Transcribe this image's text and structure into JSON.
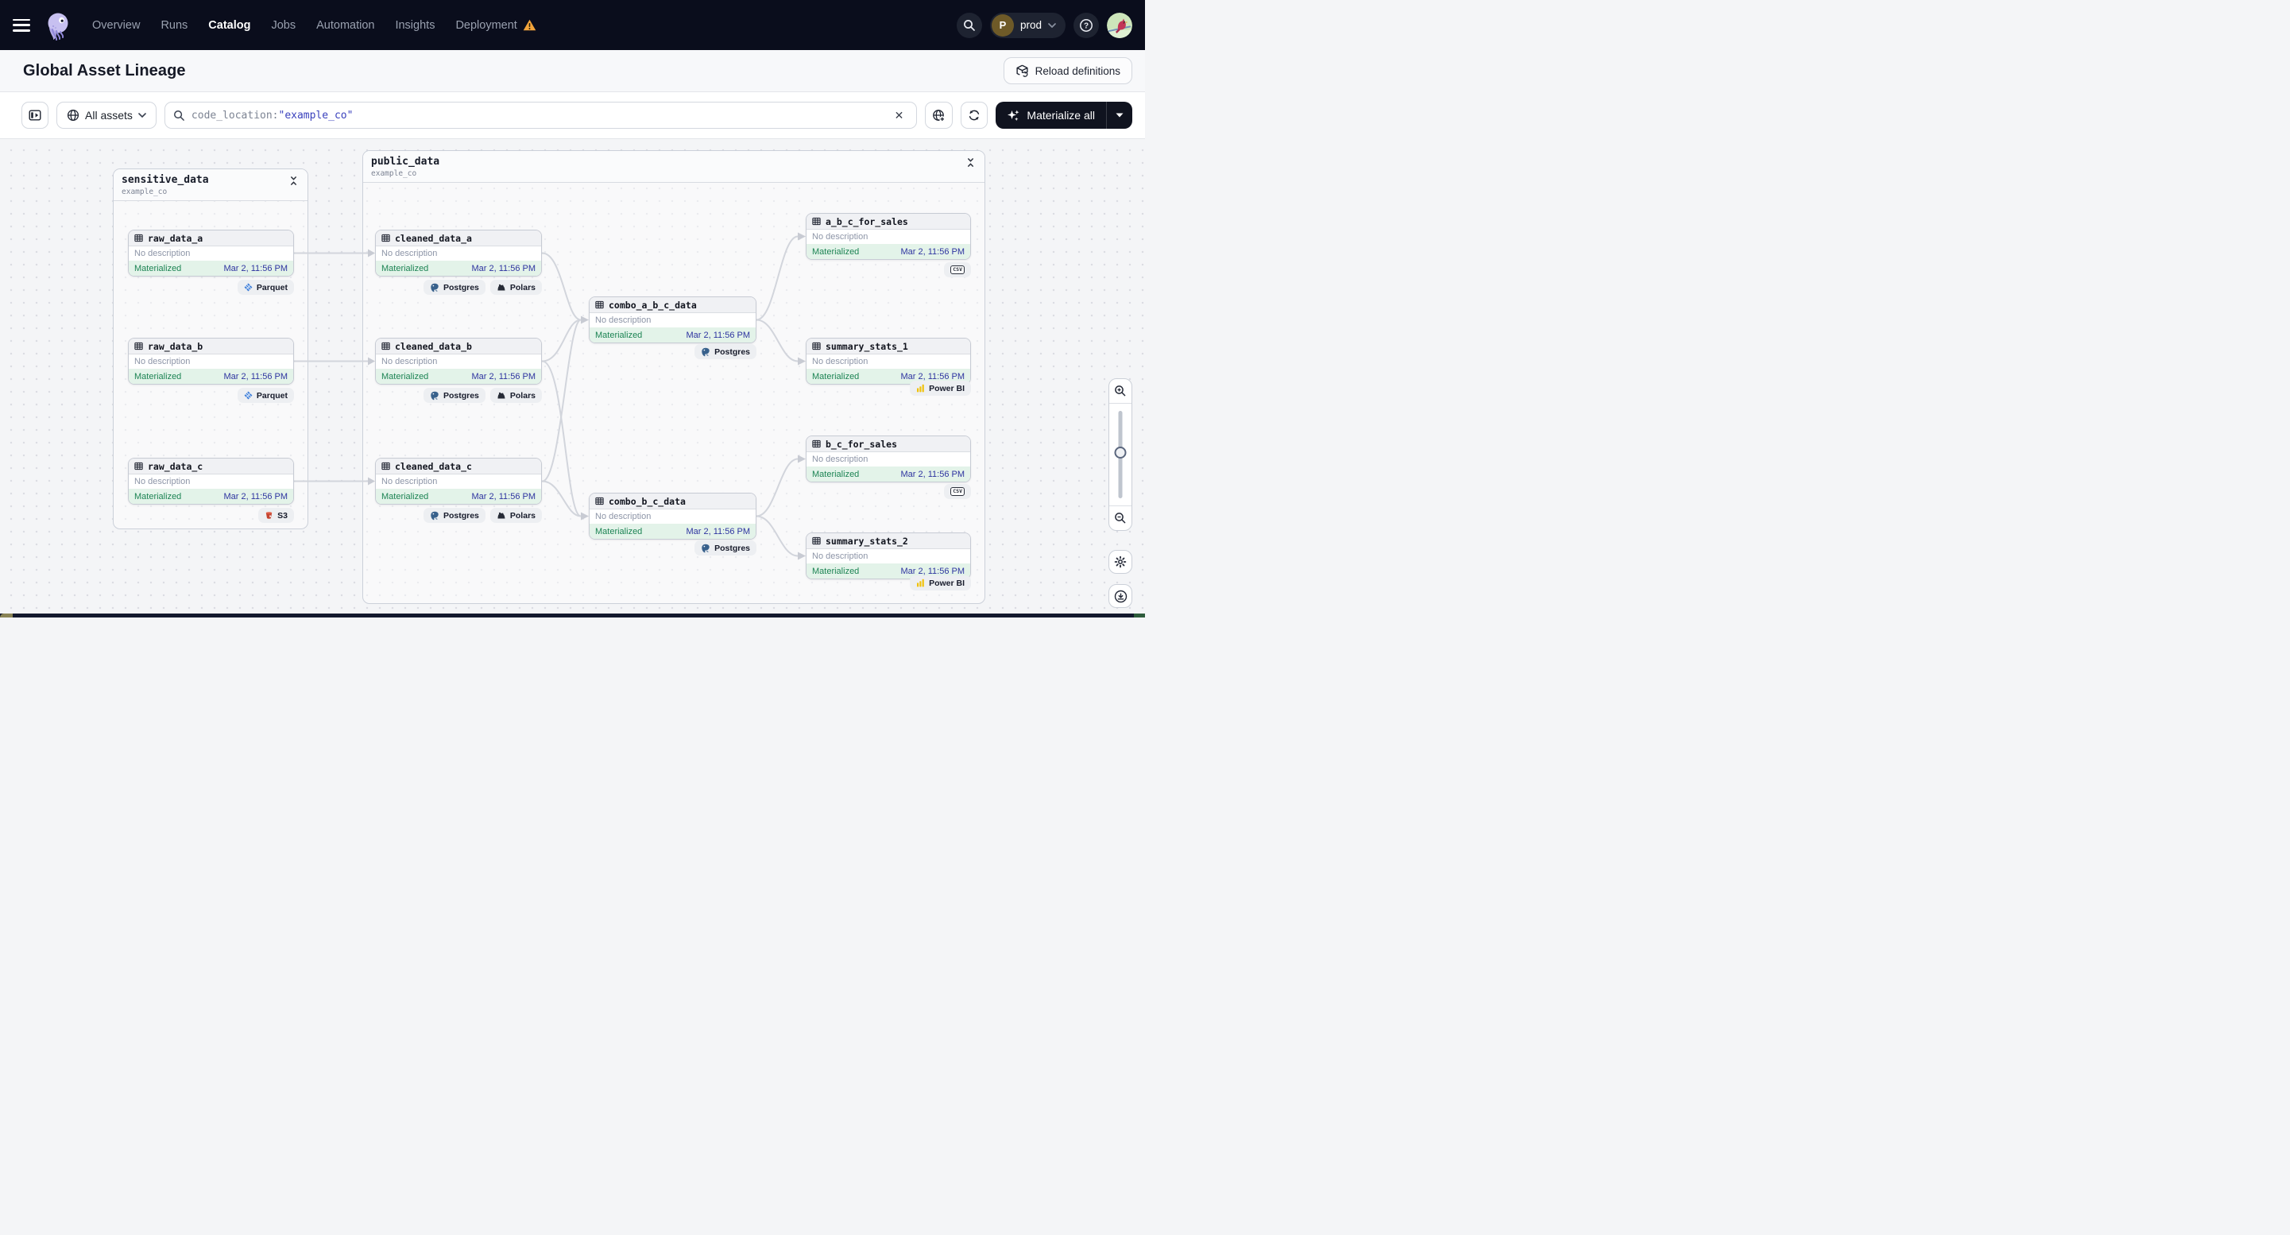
{
  "nav": {
    "items": [
      {
        "label": "Overview",
        "active": false
      },
      {
        "label": "Runs",
        "active": false
      },
      {
        "label": "Catalog",
        "active": true
      },
      {
        "label": "Jobs",
        "active": false
      },
      {
        "label": "Automation",
        "active": false
      },
      {
        "label": "Insights",
        "active": false
      },
      {
        "label": "Deployment",
        "active": false,
        "warning": true
      }
    ],
    "deployment": {
      "label": "prod",
      "avatar_initial": "P"
    }
  },
  "header": {
    "title": "Global Asset Lineage",
    "reload_label": "Reload definitions"
  },
  "toolbar": {
    "filter_label": "All assets",
    "search_prefix": "code_location:",
    "search_value": "\"example_co\"",
    "clear_icon": "close-icon",
    "materialize_label": "Materialize all"
  },
  "graph": {
    "groups": [
      {
        "name": "sensitive_data",
        "location": "example_co"
      },
      {
        "name": "public_data",
        "location": "example_co"
      }
    ],
    "nodes": [
      {
        "name": "raw_data_a",
        "description": "No description",
        "status": "Materialized",
        "timestamp": "Mar 2, 11:56 PM",
        "tags": [
          {
            "icon": "parquet-icon",
            "label": "Parquet"
          }
        ]
      },
      {
        "name": "raw_data_b",
        "description": "No description",
        "status": "Materialized",
        "timestamp": "Mar 2, 11:56 PM",
        "tags": [
          {
            "icon": "parquet-icon",
            "label": "Parquet"
          }
        ]
      },
      {
        "name": "raw_data_c",
        "description": "No description",
        "status": "Materialized",
        "timestamp": "Mar 2, 11:56 PM",
        "tags": [
          {
            "icon": "s3-icon",
            "label": "S3"
          }
        ]
      },
      {
        "name": "cleaned_data_a",
        "description": "No description",
        "status": "Materialized",
        "timestamp": "Mar 2, 11:56 PM",
        "tags": [
          {
            "icon": "postgres-icon",
            "label": "Postgres"
          },
          {
            "icon": "polars-icon",
            "label": "Polars"
          }
        ]
      },
      {
        "name": "cleaned_data_b",
        "description": "No description",
        "status": "Materialized",
        "timestamp": "Mar 2, 11:56 PM",
        "tags": [
          {
            "icon": "postgres-icon",
            "label": "Postgres"
          },
          {
            "icon": "polars-icon",
            "label": "Polars"
          }
        ]
      },
      {
        "name": "cleaned_data_c",
        "description": "No description",
        "status": "Materialized",
        "timestamp": "Mar 2, 11:56 PM",
        "tags": [
          {
            "icon": "postgres-icon",
            "label": "Postgres"
          },
          {
            "icon": "polars-icon",
            "label": "Polars"
          }
        ]
      },
      {
        "name": "combo_a_b_c_data",
        "description": "No description",
        "status": "Materialized",
        "timestamp": "Mar 2, 11:56 PM",
        "tags": [
          {
            "icon": "postgres-icon",
            "label": "Postgres"
          }
        ]
      },
      {
        "name": "combo_b_c_data",
        "description": "No description",
        "status": "Materialized",
        "timestamp": "Mar 2, 11:56 PM",
        "tags": [
          {
            "icon": "postgres-icon",
            "label": "Postgres"
          }
        ]
      },
      {
        "name": "a_b_c_for_sales",
        "description": "No description",
        "status": "Materialized",
        "timestamp": "Mar 2, 11:56 PM",
        "tags": [
          {
            "icon": "csv-icon",
            "label": "CSV"
          }
        ]
      },
      {
        "name": "summary_stats_1",
        "description": "No description",
        "status": "Materialized",
        "timestamp": "Mar 2, 11:56 PM",
        "tags": [
          {
            "icon": "powerbi-icon",
            "label": "Power BI"
          }
        ]
      },
      {
        "name": "b_c_for_sales",
        "description": "No description",
        "status": "Materialized",
        "timestamp": "Mar 2, 11:56 PM",
        "tags": [
          {
            "icon": "csv-icon",
            "label": "CSV"
          }
        ]
      },
      {
        "name": "summary_stats_2",
        "description": "No description",
        "status": "Materialized",
        "timestamp": "Mar 2, 11:56 PM",
        "tags": [
          {
            "icon": "powerbi-icon",
            "label": "Power BI"
          }
        ]
      }
    ]
  },
  "controls": {
    "zoom_in": "zoom-in-icon",
    "zoom_out": "zoom-out-icon",
    "settings": "gear-icon",
    "download": "download-icon"
  },
  "colors": {
    "nav_bg": "#0A0D1C",
    "materialize_bg": "#10131F",
    "status_green": "#1D8454",
    "status_bg": "#E3F3E9",
    "timestamp_indigo": "#2E34A0",
    "search_term_indigo": "#3A41BD",
    "warning_orange": "#F2A43B",
    "powerbi_yellow": "#F0C20C",
    "parquet_blue": "#3E7ED8",
    "s3_red": "#C4432F",
    "postgres_blue": "#38618C",
    "polars_dark": "#262B36"
  }
}
